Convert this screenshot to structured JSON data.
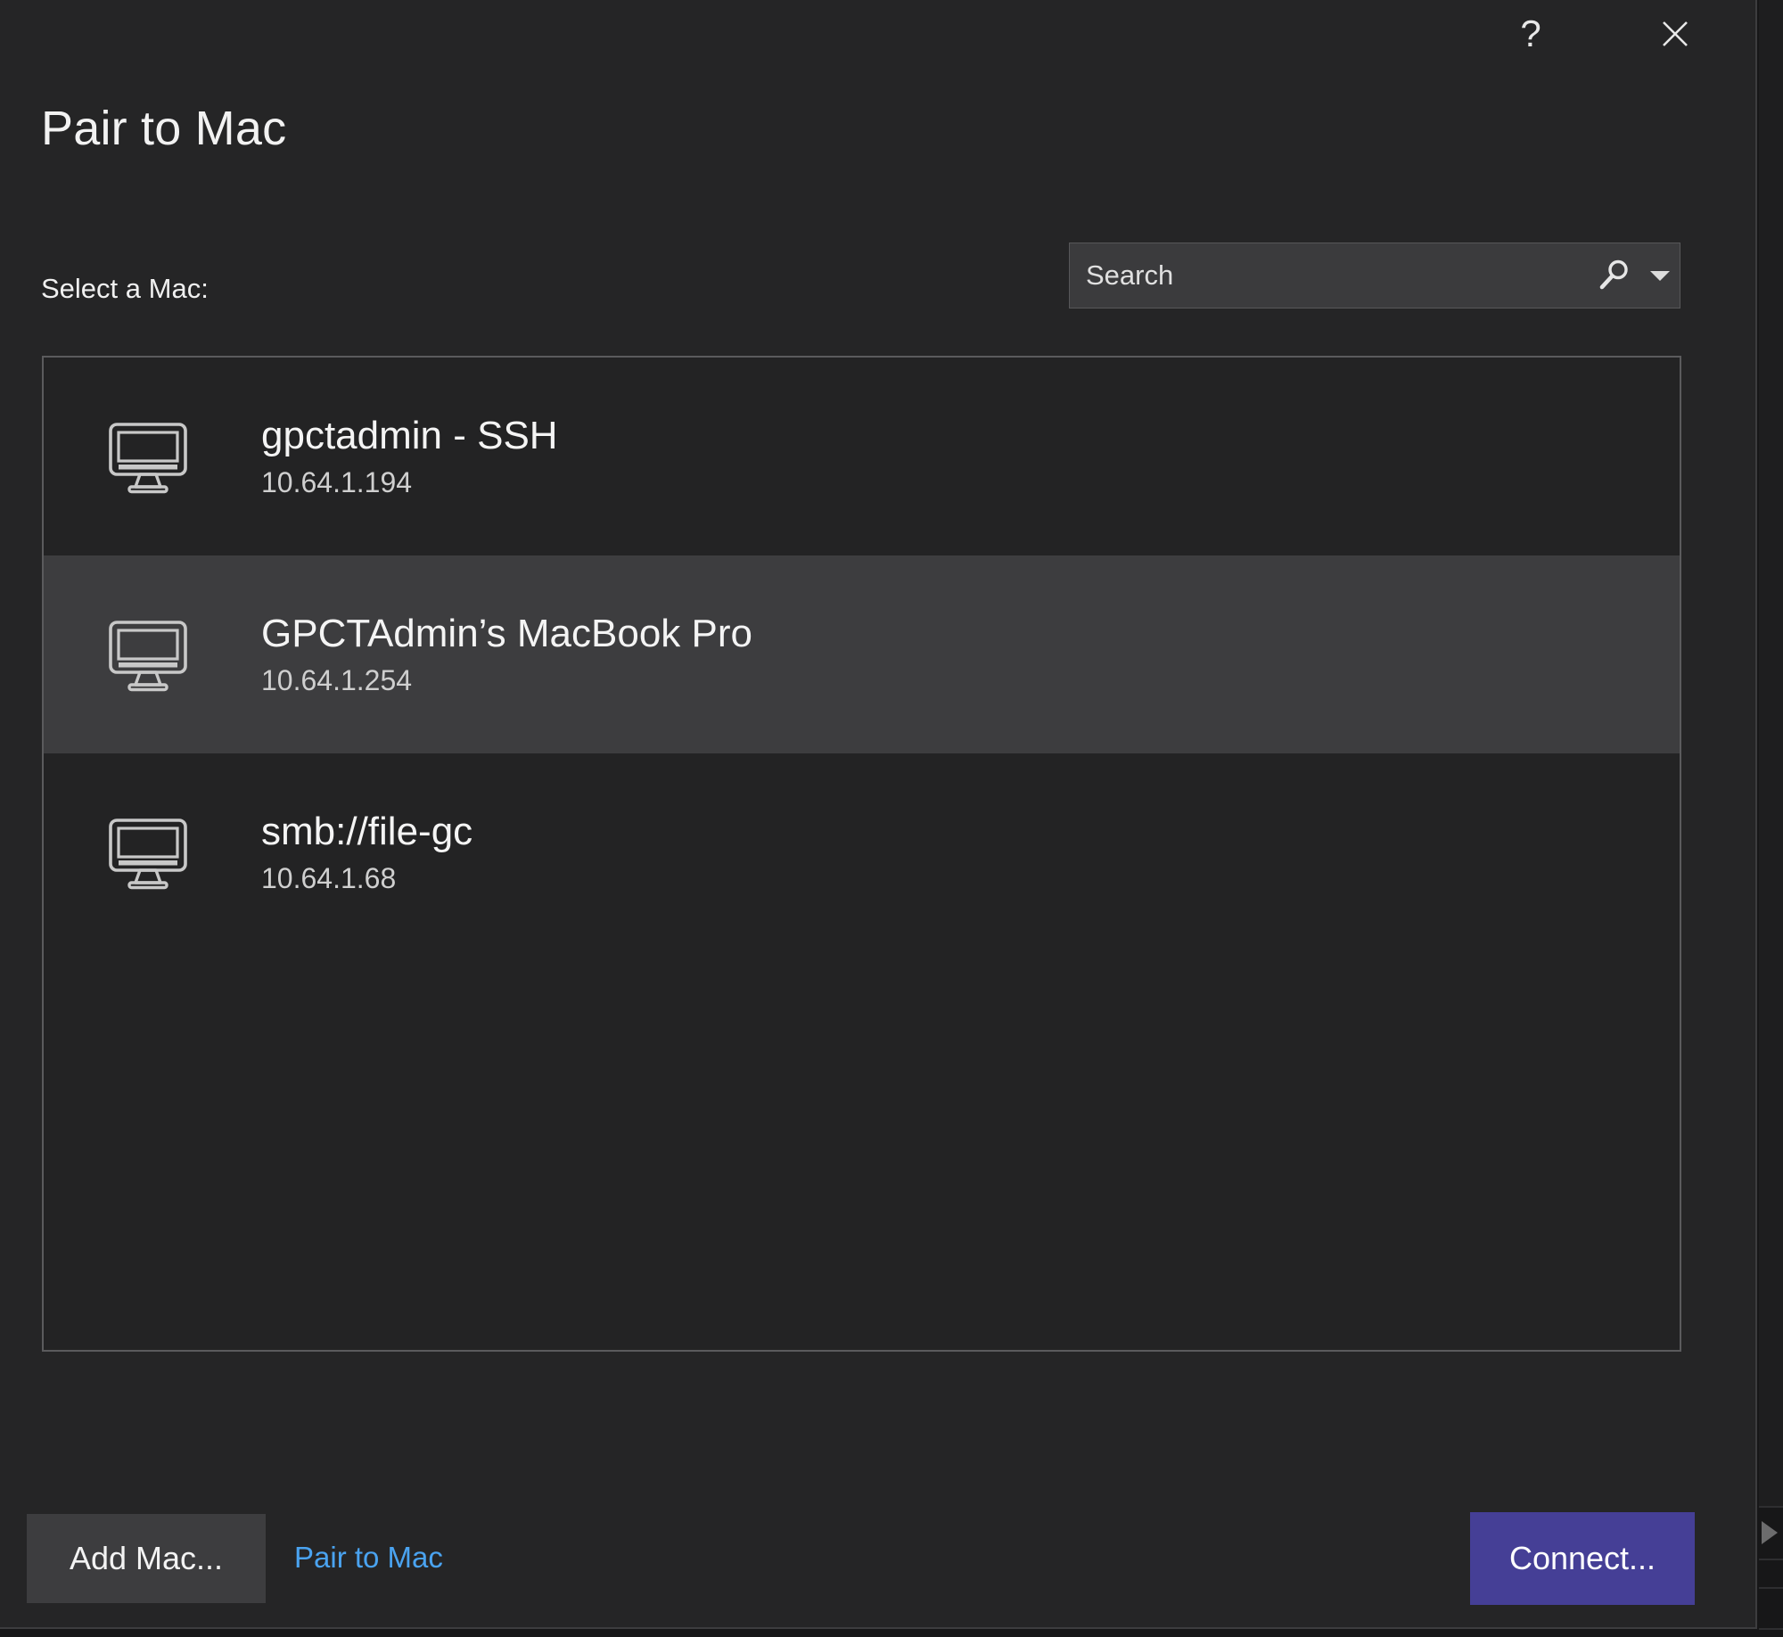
{
  "window": {
    "title": "Pair to Mac",
    "help_label": "?",
    "close_label": "✕"
  },
  "form": {
    "select_label": "Select a Mac:"
  },
  "search": {
    "value": "",
    "placeholder": "Search",
    "icon": "search-icon",
    "dropdown_icon": "chevron-down-icon"
  },
  "mac_list": {
    "items": [
      {
        "name": "gpctadmin - SSH",
        "ip": "10.64.1.194",
        "icon": "monitor-icon",
        "selected": false
      },
      {
        "name": "GPCTAdmin’s MacBook Pro",
        "ip": "10.64.1.254",
        "icon": "monitor-icon",
        "selected": true
      },
      {
        "name": "smb://file-gc",
        "ip": "10.64.1.68",
        "icon": "monitor-icon",
        "selected": false
      }
    ]
  },
  "footer": {
    "add_mac_label": "Add Mac...",
    "pair_to_mac_label": "Pair to Mac",
    "connect_label": "Connect..."
  },
  "colors": {
    "dialog_background": "#252526",
    "list_background": "#232324",
    "selected_row": "#3d3d3f",
    "accent_connect": "#453f96",
    "link_blue": "#4aa3f0",
    "text_primary": "#f2f2f2",
    "text_secondary": "#cfcfcf",
    "border": "#5b5b5d"
  }
}
